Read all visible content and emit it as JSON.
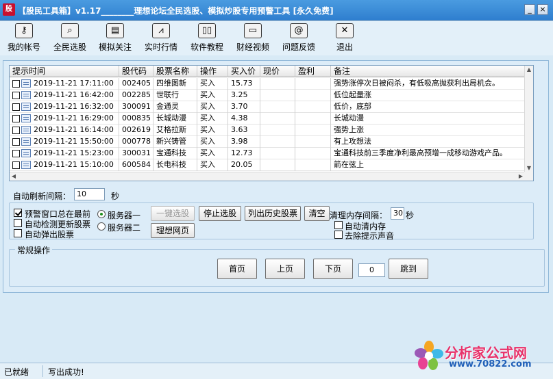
{
  "window": {
    "logo": "股",
    "title": "【股民工具箱】v1.17________理想论坛全民选股、模拟炒股专用预警工具 [永久免费]",
    "minimize": "_",
    "close": "×"
  },
  "toolbar": [
    {
      "label": "我的帐号",
      "icon": "key-icon",
      "glyph": "⚷"
    },
    {
      "label": "全民选股",
      "icon": "search-icon",
      "glyph": "⌕"
    },
    {
      "label": "模拟关注",
      "icon": "document-icon",
      "glyph": "▤"
    },
    {
      "label": "实时行情",
      "icon": "chart-icon",
      "glyph": "⩘"
    },
    {
      "label": "软件教程",
      "icon": "book-icon",
      "glyph": "▯▯"
    },
    {
      "label": "财经视频",
      "icon": "video-icon",
      "glyph": "▭"
    },
    {
      "label": "问题反馈",
      "icon": "at-icon",
      "glyph": "@"
    },
    {
      "label": "退出",
      "icon": "exit-icon",
      "glyph": "✕"
    }
  ],
  "grid": {
    "columns": [
      "提示时间",
      "股代码",
      "股票名称",
      "操作",
      "买入价",
      "现价",
      "盈利",
      "备注"
    ],
    "rows": [
      {
        "time": "2019-11-21 17:11:00",
        "code": "002405",
        "name": "四维图新",
        "op": "买入",
        "price": "15.73",
        "cur": "",
        "profit": "",
        "note": "强势涨停次日被闷杀，有低吸高抛获利出局机会。"
      },
      {
        "time": "2019-11-21 16:42:00",
        "code": "002285",
        "name": "世联行",
        "op": "买入",
        "price": "3.25",
        "cur": "",
        "profit": "",
        "note": "低位起量涨"
      },
      {
        "time": "2019-11-21 16:32:00",
        "code": "300091",
        "name": "金通灵",
        "op": "买入",
        "price": "3.70",
        "cur": "",
        "profit": "",
        "note": "低价，底部"
      },
      {
        "time": "2019-11-21 16:29:00",
        "code": "000835",
        "name": "长城动漫",
        "op": "买入",
        "price": "4.38",
        "cur": "",
        "profit": "",
        "note": "长城动漫"
      },
      {
        "time": "2019-11-21 16:14:00",
        "code": "002619",
        "name": "艾格拉斯",
        "op": "买入",
        "price": "3.63",
        "cur": "",
        "profit": "",
        "note": "强势上涨"
      },
      {
        "time": "2019-11-21 15:50:00",
        "code": "000778",
        "name": "新兴铸管",
        "op": "买入",
        "price": "3.98",
        "cur": "",
        "profit": "",
        "note": "有上攻想法"
      },
      {
        "time": "2019-11-21 15:23:00",
        "code": "300031",
        "name": "宝通科技",
        "op": "买入",
        "price": "12.73",
        "cur": "",
        "profit": "",
        "note": "宝通科技前三季度净利最高预增一成移动游戏产品。"
      },
      {
        "time": "2019-11-21 15:10:00",
        "code": "600584",
        "name": "长电科技",
        "op": "买入",
        "price": "20.05",
        "cur": "",
        "profit": "",
        "note": "箭在弦上"
      }
    ]
  },
  "refresh": {
    "label": "自动刷新间隔：",
    "value": "10",
    "unit": "秒"
  },
  "options": {
    "always_on_top": "预警窗口总在最前",
    "auto_check_update": "自动检测更新股票",
    "auto_popup": "自动弹出股票",
    "server1": "服务器一",
    "server2": "服务器二"
  },
  "buttons": {
    "one_click": "一键选股",
    "stop": "停止选股",
    "history": "列出历史股票",
    "clear": "清空",
    "web": "理想网页"
  },
  "memory": {
    "label": "清理内存间隔：",
    "value": "30",
    "unit": "秒",
    "auto_clean": "自动清内存",
    "mute": "去除提示声音"
  },
  "normal_ops": {
    "title": "常规操作",
    "first": "首页",
    "prev": "上页",
    "next": "下页",
    "page_value": "0",
    "jump": "跳到"
  },
  "status": {
    "ready": "已就绪",
    "message": "写出成功!"
  },
  "watermark": {
    "title": "分析家公式网",
    "url": "www.70822.com"
  },
  "colors": {
    "titlebar": "#2f7fcf",
    "panel": "#dcecf8",
    "watermark_pink": "#e8326a",
    "watermark_blue": "#1f5fb8"
  }
}
